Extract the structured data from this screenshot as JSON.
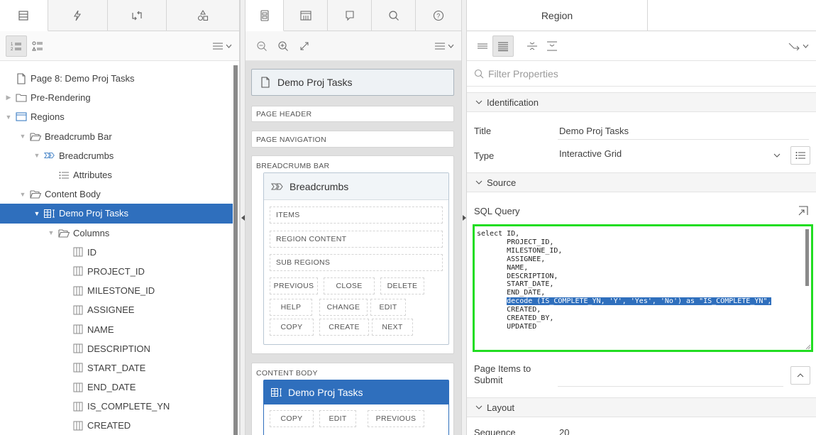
{
  "left": {
    "tree": [
      {
        "label": "Page 8: Demo Proj Tasks",
        "indent": 0,
        "toggle": "",
        "icon": "page-icon"
      },
      {
        "label": "Pre-Rendering",
        "indent": 0,
        "toggle": "▶",
        "icon": "folder-icon"
      },
      {
        "label": "Regions",
        "indent": 0,
        "toggle": "▼",
        "icon": "region-icon"
      },
      {
        "label": "Breadcrumb Bar",
        "indent": 1,
        "toggle": "▼",
        "icon": "folder-open-icon"
      },
      {
        "label": "Breadcrumbs",
        "indent": 2,
        "toggle": "▼",
        "icon": "breadcrumb-icon"
      },
      {
        "label": "Attributes",
        "indent": 3,
        "toggle": "",
        "icon": "attributes-icon"
      },
      {
        "label": "Content Body",
        "indent": 1,
        "toggle": "▼",
        "icon": "folder-open-icon"
      },
      {
        "label": "Demo Proj Tasks",
        "indent": 2,
        "toggle": "▼",
        "icon": "grid-icon",
        "selected": true
      },
      {
        "label": "Columns",
        "indent": 3,
        "toggle": "▼",
        "icon": "folder-open-icon"
      },
      {
        "label": "ID",
        "indent": 4,
        "toggle": "",
        "icon": "column-icon"
      },
      {
        "label": "PROJECT_ID",
        "indent": 4,
        "toggle": "",
        "icon": "column-icon"
      },
      {
        "label": "MILESTONE_ID",
        "indent": 4,
        "toggle": "",
        "icon": "column-icon"
      },
      {
        "label": "ASSIGNEE",
        "indent": 4,
        "toggle": "",
        "icon": "column-icon"
      },
      {
        "label": "NAME",
        "indent": 4,
        "toggle": "",
        "icon": "column-icon"
      },
      {
        "label": "DESCRIPTION",
        "indent": 4,
        "toggle": "",
        "icon": "column-icon"
      },
      {
        "label": "START_DATE",
        "indent": 4,
        "toggle": "",
        "icon": "column-icon"
      },
      {
        "label": "END_DATE",
        "indent": 4,
        "toggle": "",
        "icon": "column-icon"
      },
      {
        "label": "IS_COMPLETE_YN",
        "indent": 4,
        "toggle": "",
        "icon": "column-icon"
      },
      {
        "label": "CREATED",
        "indent": 4,
        "toggle": "",
        "icon": "column-icon"
      }
    ]
  },
  "mid": {
    "page_title": "Demo Proj Tasks",
    "page_header": "PAGE HEADER",
    "page_navigation": "PAGE NAVIGATION",
    "breadcrumb_bar": "BREADCRUMB BAR",
    "breadcrumbs_region": "Breadcrumbs",
    "items": "ITEMS",
    "region_content": "REGION CONTENT",
    "sub_regions": "SUB REGIONS",
    "buttons_row1": [
      "PREVIOUS",
      "CLOSE",
      "DELETE"
    ],
    "buttons_row2": [
      "HELP",
      "CHANGE",
      "EDIT"
    ],
    "buttons_row3": [
      "COPY",
      "CREATE",
      "NEXT"
    ],
    "content_body": "CONTENT BODY",
    "grid_region": "Demo Proj Tasks",
    "grid_buttons": [
      "COPY",
      "EDIT",
      "PREVIOUS"
    ]
  },
  "right": {
    "tab_label": "Region",
    "filter_placeholder": "Filter Properties",
    "identification": "Identification",
    "title_label": "Title",
    "title_value": "Demo Proj Tasks",
    "type_label": "Type",
    "type_value": "Interactive Grid",
    "source": "Source",
    "sql_label": "SQL Query",
    "sql_lines_before": "select ID,\n       PROJECT_ID,\n       MILESTONE_ID,\n       ASSIGNEE,\n       NAME,\n       DESCRIPTION,\n       START_DATE,\n       END_DATE,\n       ",
    "sql_highlight": "decode (IS_COMPLETE_YN, 'Y', 'Yes', 'No') as \"IS_COMPLETE_YN\",",
    "sql_lines_after": "\n       CREATED,\n       CREATED_BY,\n       UPDATED",
    "page_items_label": "Page Items to Submit",
    "layout": "Layout",
    "sequence_label": "Sequence",
    "sequence_value": "20"
  },
  "colors": {
    "selection": "#2f6fbd",
    "highlight_border": "#22dd22"
  }
}
